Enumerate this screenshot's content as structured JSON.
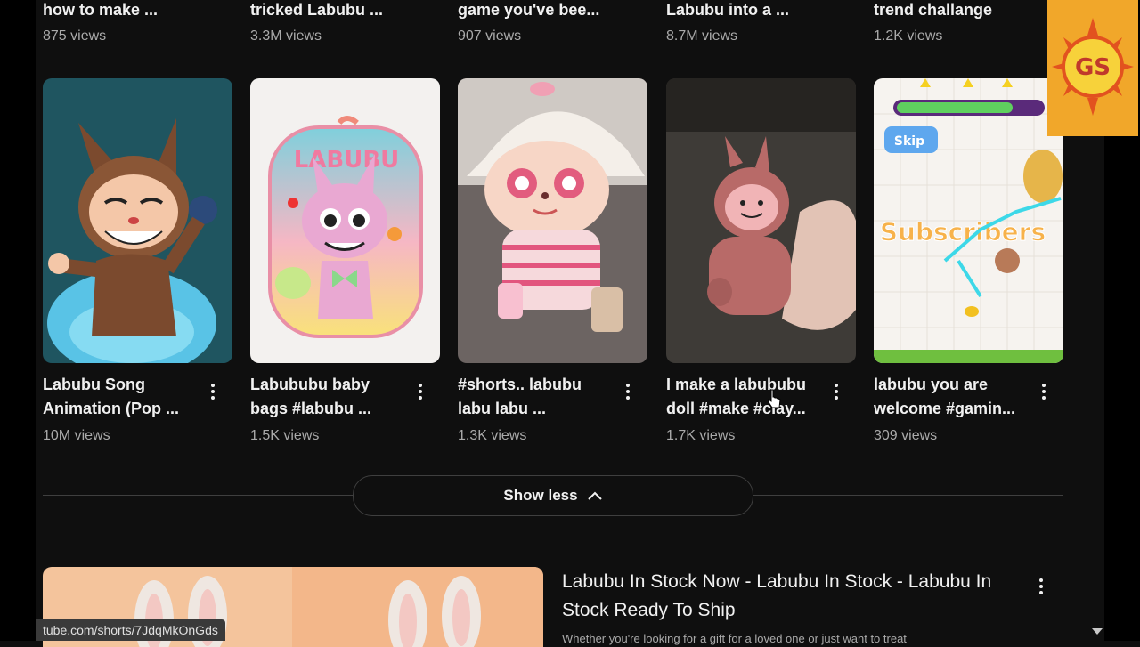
{
  "top_row": [
    {
      "title": "how to make ...",
      "views": "875 views"
    },
    {
      "title": "tricked Labubu ...",
      "views": "3.3M views"
    },
    {
      "title": "game you've bee...",
      "views": "907 views"
    },
    {
      "title": "Labubu into a ...",
      "views": "8.7M views"
    },
    {
      "title": "trend challange",
      "views": "1.2K views"
    }
  ],
  "shorts": [
    {
      "title_line1": "Labubu Song",
      "title_line2": "Animation (Pop ...",
      "views": "10M views"
    },
    {
      "title_line1": "Labububu baby",
      "title_line2": "bags #labubu ...",
      "views": "1.5K views"
    },
    {
      "title_line1": "#shorts.. labubu",
      "title_line2": "labu labu ...",
      "views": "1.3K views"
    },
    {
      "title_line1": "I make a labububu",
      "title_line2": "doll #make #clay...",
      "views": "1.7K views"
    },
    {
      "title_line1": "labubu you are",
      "title_line2": "welcome #gamin...",
      "views": "309 views"
    }
  ],
  "thumbnail_text": {
    "bag_brand": "LABUBU",
    "game_skip": "Skip",
    "game_banner": "Subscribers"
  },
  "show_less": {
    "label": "Show less"
  },
  "video": {
    "title": "Labubu In Stock Now - Labubu In Stock - Labubu In Stock Ready To Ship",
    "description": "Whether you're looking for a gift for a loved one or just want to treat"
  },
  "status_bar": {
    "url": "tube.com/shorts/7JdqMkOnGds"
  },
  "watermark": {
    "text": "GS"
  },
  "colors": {
    "background": "#0f0f0f",
    "text": "#f1f1f1",
    "secondary_text": "#aaaaaa",
    "border": "#3f3f3f"
  }
}
